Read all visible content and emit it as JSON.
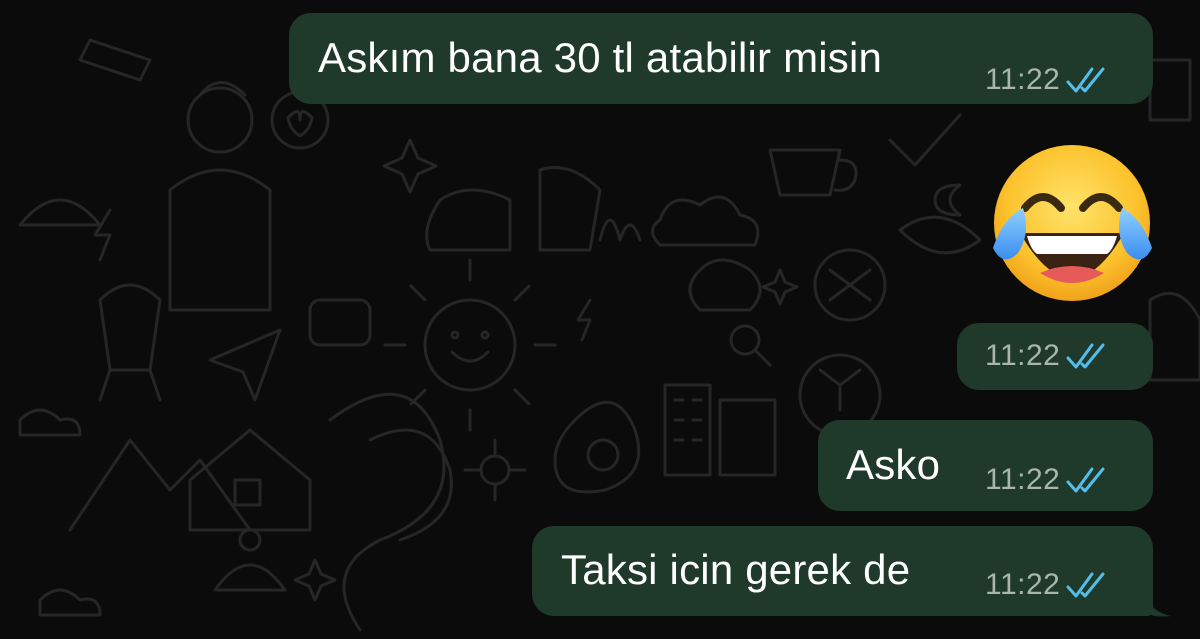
{
  "messages": [
    {
      "text": "Askım bana 30 tl atabilir misin",
      "time": "11:22",
      "status": "read"
    },
    {
      "emoji": "face-with-tears-of-joy",
      "time": "11:22",
      "status": "read"
    },
    {
      "text": "Asko",
      "time": "11:22",
      "status": "read"
    },
    {
      "text": "Taksi icin gerek de",
      "time": "11:22",
      "status": "read"
    }
  ],
  "colors": {
    "background": "#0b0b0b",
    "outgoing_bubble": "#1f3a2a",
    "read_ticks": "#53bdeb",
    "timestamp": "#a8b6ad",
    "doodle": "#2a2a2a"
  }
}
